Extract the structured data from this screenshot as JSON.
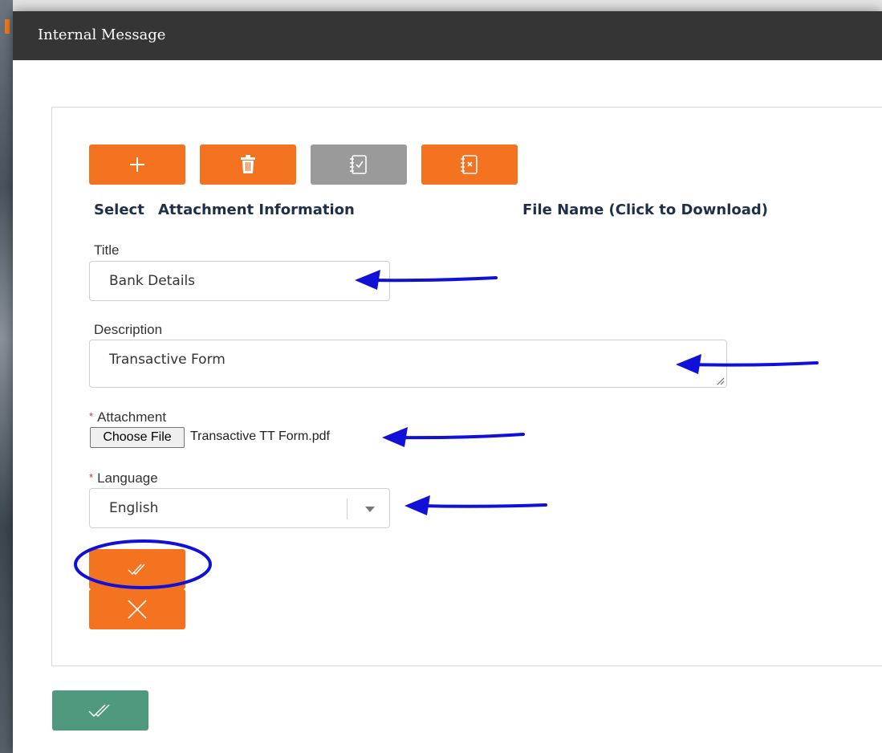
{
  "modal": {
    "title": "Internal Message"
  },
  "toolbar": {
    "add_icon": "plus-icon",
    "delete_icon": "trash-icon",
    "select_all_icon": "checklist-icon",
    "deselect_icon": "checklist-x-icon"
  },
  "columns": {
    "select": "Select",
    "attachment_info": "Attachment Information",
    "file_name": "File Name (Click to Download)"
  },
  "form": {
    "title_label": "Title",
    "title_value": "Bank Details",
    "description_label": "Description",
    "description_value": "Transactive Form",
    "attachment_label": "Attachment",
    "choose_file_label": "Choose File",
    "attachment_file_name": "Transactive TT Form.pdf",
    "language_label": "Language",
    "language_value": "English",
    "required_marker": "*"
  },
  "actions": {
    "confirm_icon": "double-check-icon",
    "cancel_icon": "close-icon",
    "footer_confirm_icon": "double-check-icon"
  },
  "colors": {
    "header_bg": "#353535",
    "primary_orange": "#f47320",
    "gray_button": "#9a9a9a",
    "green_button": "#4f9a7e",
    "annotation_blue": "#1010d8"
  }
}
